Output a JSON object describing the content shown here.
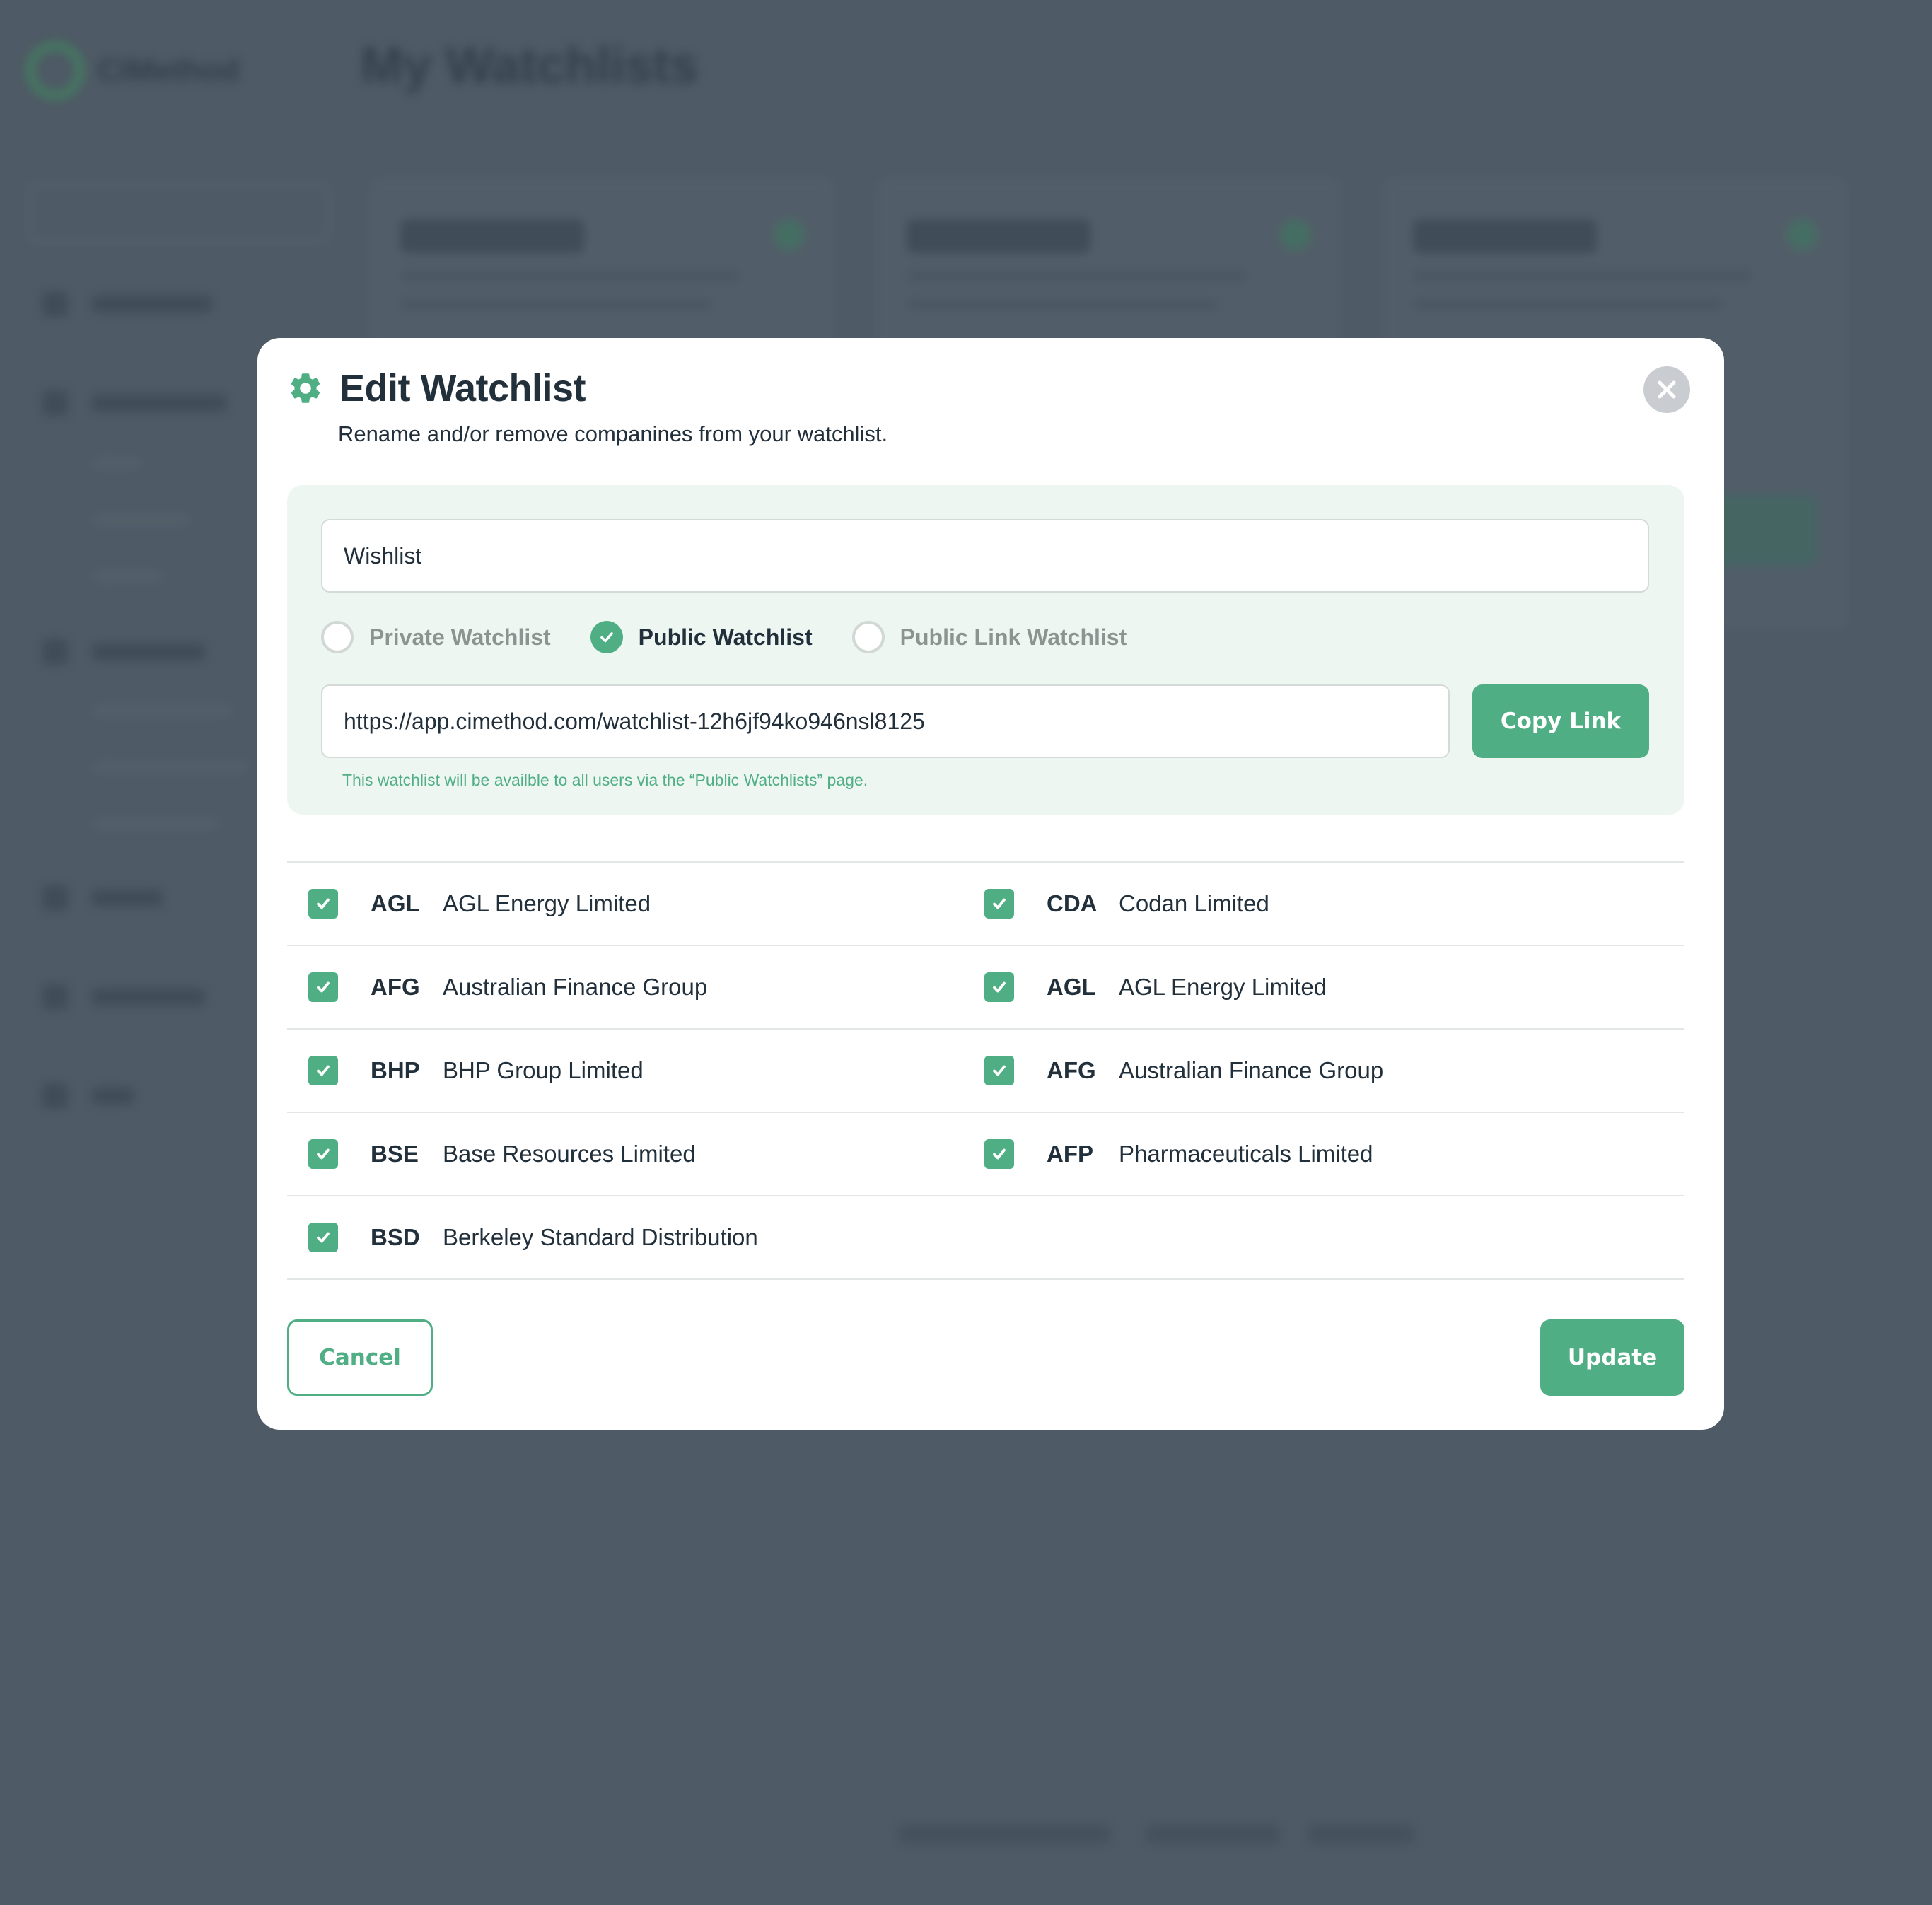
{
  "colors": {
    "overlay": "#4e5a65",
    "accent": "#4fae84",
    "panel_bg": "#eef6f2",
    "text": "#22303c",
    "muted_text": "#8a9591"
  },
  "background": {
    "logo_text": "CIMethod",
    "page_title": "My Watchlists"
  },
  "modal": {
    "icon": "gear-icon",
    "title": "Edit Watchlist",
    "subtitle": "Rename and/or remove companines from your watchlist.",
    "close_icon": "close-icon",
    "name_input_value": "Wishlist",
    "visibility_options": [
      {
        "label": "Private Watchlist",
        "selected": false
      },
      {
        "label": "Public Watchlist",
        "selected": true
      },
      {
        "label": "Public Link Watchlist",
        "selected": false
      }
    ],
    "link_value": "https://app.cimethod.com/watchlist-12h6jf94ko946nsl8125",
    "copy_link_label": "Copy Link",
    "helper_text": "This watchlist will be availble to all users via the “Public Watchlists” page.",
    "companies_left": [
      {
        "ticker": "AGL",
        "name": "AGL Energy Limited",
        "checked": true
      },
      {
        "ticker": "AFG",
        "name": "Australian Finance Group",
        "checked": true
      },
      {
        "ticker": "BHP",
        "name": "BHP Group Limited",
        "checked": true
      },
      {
        "ticker": "BSE",
        "name": "Base Resources Limited",
        "checked": true
      },
      {
        "ticker": "BSD",
        "name": "Berkeley Standard Distribution",
        "checked": true
      }
    ],
    "companies_right": [
      {
        "ticker": "CDA",
        "name": "Codan Limited",
        "checked": true
      },
      {
        "ticker": "AGL",
        "name": "AGL Energy Limited",
        "checked": true
      },
      {
        "ticker": "AFG",
        "name": "Australian Finance Group",
        "checked": true
      },
      {
        "ticker": "AFP",
        "name": "Pharmaceuticals Limited",
        "checked": true
      }
    ],
    "cancel_label": "Cancel",
    "update_label": "Update"
  }
}
